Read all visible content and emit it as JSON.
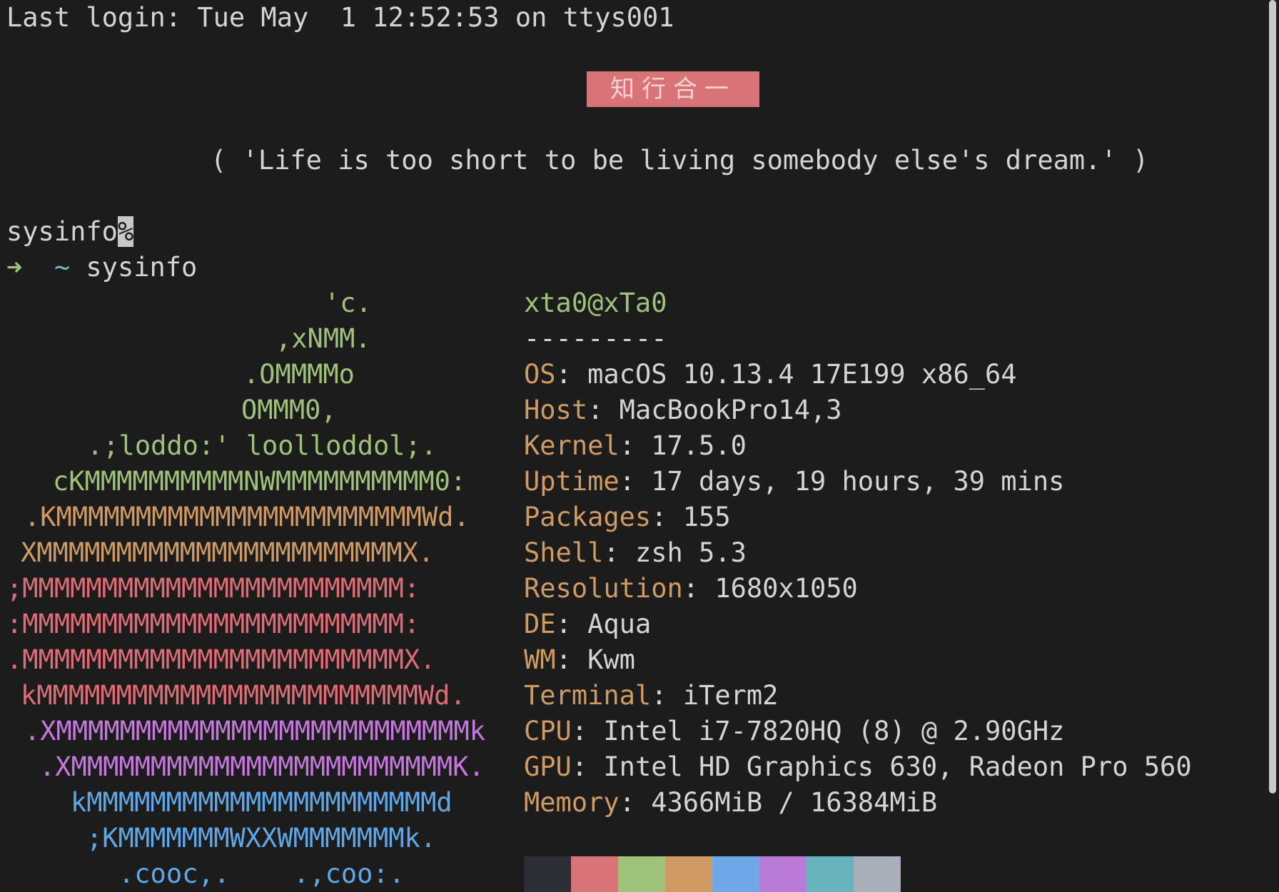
{
  "terminal": {
    "last_login": "Last login: Tue May  1 12:52:53 on ttys001",
    "banner": "知行合一",
    "quote": "( 'Life is too short to be living somebody else's dream.' )",
    "prompt_line_text": "sysinfo",
    "prompt_line_cursor": "%",
    "prompt_arrow": "➜",
    "prompt_dir": "~",
    "command": "sysinfo"
  },
  "logo": {
    "lines": [
      {
        "text": "'c.",
        "color": "green"
      },
      {
        "text": ",xNMM.",
        "color": "green"
      },
      {
        "text": ".OMMMMo",
        "color": "green"
      },
      {
        "text": "OMMM0,",
        "color": "green"
      },
      {
        "text": ".;loddo:' loolloddol;.",
        "color": "green"
      },
      {
        "text": "cKMMMMMMMMMMNWMMMMMMMMMM0:",
        "color": "green"
      },
      {
        "text": ".KMMMMMMMMMMMMMMMMMMMMMMMWd.",
        "color": "yellow"
      },
      {
        "text": "XMMMMMMMMMMMMMMMMMMMMMMMX.",
        "color": "yellow"
      },
      {
        "text": ";MMMMMMMMMMMMMMMMMMMMMMMM:",
        "color": "red"
      },
      {
        "text": ":MMMMMMMMMMMMMMMMMMMMMMMM:",
        "color": "red"
      },
      {
        "text": ".MMMMMMMMMMMMMMMMMMMMMMMMX.",
        "color": "red"
      },
      {
        "text": "kMMMMMMMMMMMMMMMMMMMMMMMMWd.",
        "color": "red"
      },
      {
        "text": ".XMMMMMMMMMMMMMMMMMMMMMMMMMMk",
        "color": "purple"
      },
      {
        "text": ".XMMMMMMMMMMMMMMMMMMMMMMMMK.",
        "color": "purple"
      },
      {
        "text": "kMMMMMMMMMMMMMMMMMMMMMMd",
        "color": "blue"
      },
      {
        "text": ";KMMMMMMMWXXWMMMMMMMk.",
        "color": "blue"
      },
      {
        "text": ".cooc,.    .,coo:.",
        "color": "blue"
      }
    ]
  },
  "sysinfo": {
    "user_host": "xta0@xTa0",
    "separator": "---------",
    "fields": [
      {
        "key": "OS",
        "value": "macOS 10.13.4 17E199 x86_64"
      },
      {
        "key": "Host",
        "value": "MacBookPro14,3"
      },
      {
        "key": "Kernel",
        "value": "17.5.0"
      },
      {
        "key": "Uptime",
        "value": "17 days, 19 hours, 39 mins"
      },
      {
        "key": "Packages",
        "value": "155"
      },
      {
        "key": "Shell",
        "value": "zsh 5.3"
      },
      {
        "key": "Resolution",
        "value": "1680x1050"
      },
      {
        "key": "DE",
        "value": "Aqua"
      },
      {
        "key": "WM",
        "value": "Kwm"
      },
      {
        "key": "Terminal",
        "value": "iTerm2"
      },
      {
        "key": "CPU",
        "value": "Intel i7-7820HQ (8) @ 2.90GHz"
      },
      {
        "key": "GPU",
        "value": "Intel HD Graphics 630, Radeon Pro 560"
      },
      {
        "key": "Memory",
        "value": "4366MiB / 16384MiB"
      }
    ]
  },
  "palette": [
    "#2b2e35",
    "#d87377",
    "#9ec27a",
    "#d09a63",
    "#6fa8e8",
    "#b97ad8",
    "#67b3be",
    "#a8afbb"
  ],
  "colors": {
    "background": "#1c1c1c",
    "green": "#9ec27a",
    "yellow": "#d09a63",
    "red": "#e06c75",
    "purple": "#c678dd",
    "blue": "#5fa8e8",
    "banner_bg": "#d87377"
  }
}
